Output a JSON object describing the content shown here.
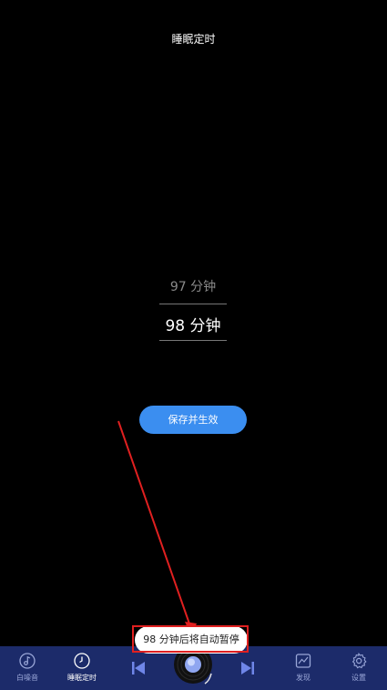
{
  "header": {
    "title": "睡眠定时"
  },
  "picker": {
    "previous_value": "97 分钟",
    "selected_value": "98 分钟"
  },
  "actions": {
    "save_label": "保存并生效"
  },
  "toast": {
    "message": "98 分钟后将自动暂停"
  },
  "bottom_nav": {
    "tabs": [
      {
        "label": "白噪音",
        "icon": "music-note-icon",
        "active": false
      },
      {
        "label": "睡眠定时",
        "icon": "clock-icon",
        "active": true
      },
      {
        "label": "发现",
        "icon": "chart-icon",
        "active": false
      },
      {
        "label": "设置",
        "icon": "gear-icon",
        "active": false
      }
    ],
    "controls": {
      "previous": "skip-previous-icon",
      "next": "skip-next-icon",
      "player": "vinyl-disc-icon"
    }
  },
  "colors": {
    "background": "#000000",
    "accent": "#3b8ef0",
    "nav_background": "#1c2b6a",
    "annotation": "#e02020"
  }
}
